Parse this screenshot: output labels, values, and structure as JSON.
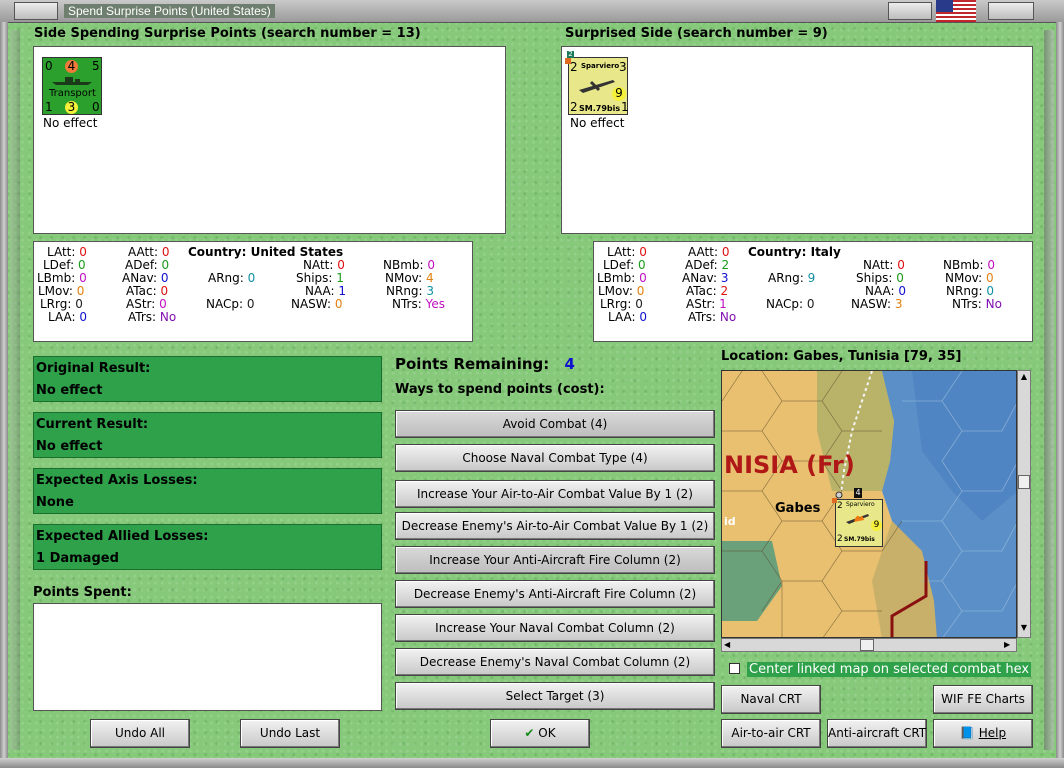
{
  "window": {
    "title": "Spend Surprise Points (United States)"
  },
  "spending_side": {
    "header": "Side Spending Surprise Points (search number = 13)",
    "unit": {
      "top_left": "0",
      "top_mid": "4",
      "top_right": "5",
      "type": "Transport",
      "bottom_left": "1",
      "bottom_mid": "3",
      "bottom_right": "0",
      "color": "#2ca02c"
    },
    "effect": "No effect"
  },
  "surprised_side": {
    "header": "Surprised Side (search number = 9)",
    "unit": {
      "badge": "2",
      "name": "Sparviero",
      "top_left": "2",
      "top_right": "3",
      "mid": "9",
      "bottom_left": "2",
      "model": "SM.79bis",
      "bottom_right": "1",
      "color": "#e8e88a"
    },
    "effect": "No effect"
  },
  "us_stats": {
    "country_label": "Country:",
    "country": "United States",
    "LAtt": "0",
    "LDef": "0",
    "LBmb": "0",
    "LMov": "0",
    "LRrg": "0",
    "LAA": "0",
    "AAtt": "0",
    "ADef": "0",
    "ANav": "0",
    "ATac": "0",
    "AStr": "0",
    "ATrs": "No",
    "ARng": "0",
    "NACp": "0",
    "NAtt": "0",
    "Ships": "1",
    "NAA": "1",
    "NASW": "0",
    "NBmb": "0",
    "NMov": "4",
    "NRng": "3",
    "NTrs": "Yes"
  },
  "it_stats": {
    "country_label": "Country:",
    "country": "Italy",
    "LAtt": "0",
    "LDef": "0",
    "LBmb": "0",
    "LMov": "0",
    "LRrg": "0",
    "LAA": "0",
    "AAtt": "0",
    "ADef": "2",
    "ANav": "3",
    "ATac": "2",
    "AStr": "1",
    "ATrs": "No",
    "ARng": "9",
    "NACp": "0",
    "NAtt": "0",
    "Ships": "0",
    "NAA": "0",
    "NASW": "3",
    "NBmb": "0",
    "NMov": "0",
    "NRng": "0",
    "NTrs": "No"
  },
  "results": {
    "original_label": "Original Result:",
    "original_value": "No effect",
    "current_label": "Current Result:",
    "current_value": "No effect",
    "axis_label": "Expected Axis Losses:",
    "axis_value": "None",
    "allied_label": "Expected Allied Losses:",
    "allied_value": "1 Damaged",
    "points_spent_label": "Points Spent:"
  },
  "points": {
    "remaining_label": "Points Remaining:",
    "remaining_value": "4",
    "ways_label": "Ways to spend points (cost):"
  },
  "options": [
    "Avoid Combat (4)",
    "Choose Naval Combat Type (4)",
    "Increase Your Air-to-Air Combat Value By 1 (2)",
    "Decrease Enemy's Air-to-Air Combat Value By 1 (2)",
    "Increase Your Anti-Aircraft Fire Column (2)",
    "Decrease Enemy's Anti-Aircraft Fire Column (2)",
    "Increase Your Naval Combat Column (2)",
    "Decrease Enemy's Naval Combat Column (2)",
    "Select Target (3)"
  ],
  "location": {
    "label": "Location:",
    "value": "Gabes, Tunisia [79, 35]",
    "map_region": "NISIA (Fr)",
    "map_city": "Gabes",
    "map_partial": "id",
    "map_stack_count": "4",
    "center_checkbox": "Center linked map on selected combat hex",
    "center_checked": false
  },
  "buttons": {
    "undo_all": "Undo All",
    "undo_last": "Undo Last",
    "ok": "OK",
    "naval_crt": "Naval CRT",
    "wif_fe": "WIF FE Charts",
    "air_crt": "Air-to-air CRT",
    "aa_crt": "Anti-aircraft CRT",
    "help": "Help"
  },
  "colors": {
    "background": "#86c97a",
    "result_box": "#2ea14a",
    "remaining_value": "#1010d0",
    "map_sea": "#5a8fc8",
    "map_desert": "#e8c070",
    "map_region_text": "#b01818"
  }
}
